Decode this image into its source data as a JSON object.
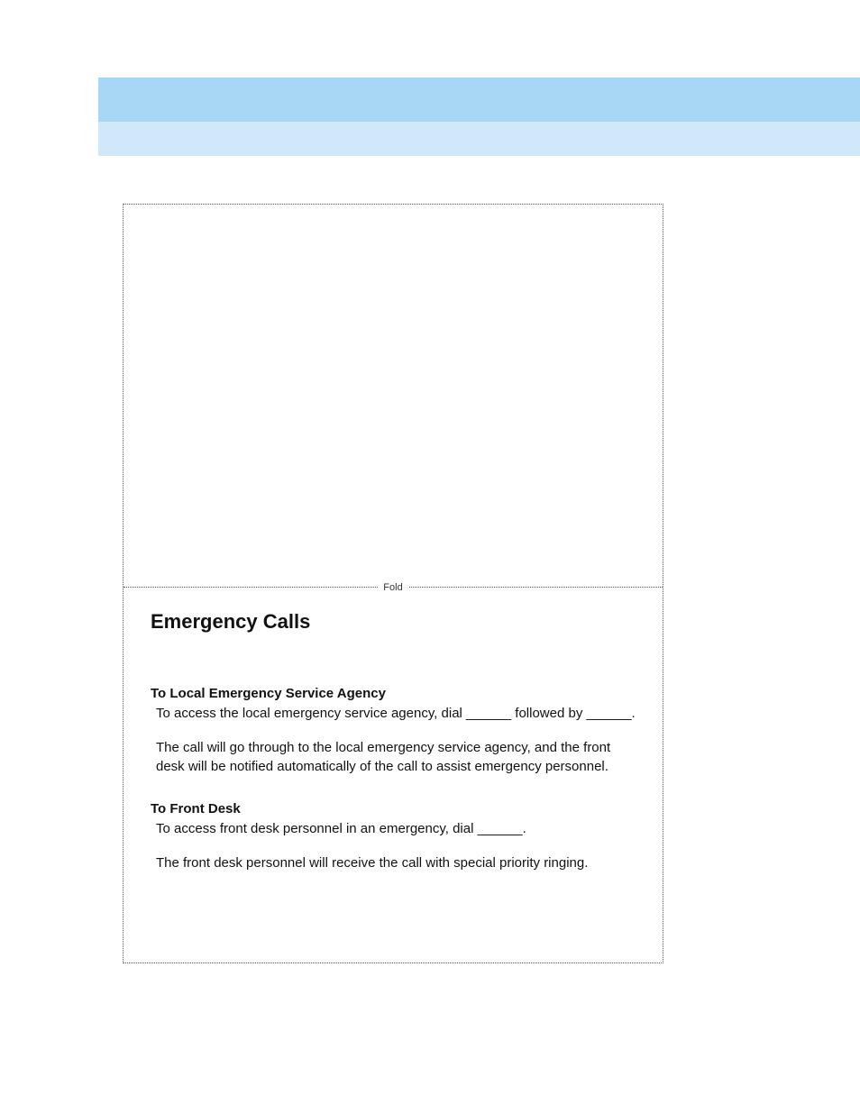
{
  "fold_label": "Fold",
  "heading": "Emergency Calls",
  "sections": [
    {
      "title": "To Local Emergency Service Agency",
      "p1": "To access the local emergency service agency, dial ______ followed by ______.",
      "p2": "The call will go through to the local emergency service agency, and the front desk will be notified automatically of the call to assist emergency personnel."
    },
    {
      "title": "To Front Desk",
      "p1": "To access front desk personnel in an emergency, dial ______.",
      "p2": "The front desk personnel will receive the call with special priority ringing."
    }
  ]
}
